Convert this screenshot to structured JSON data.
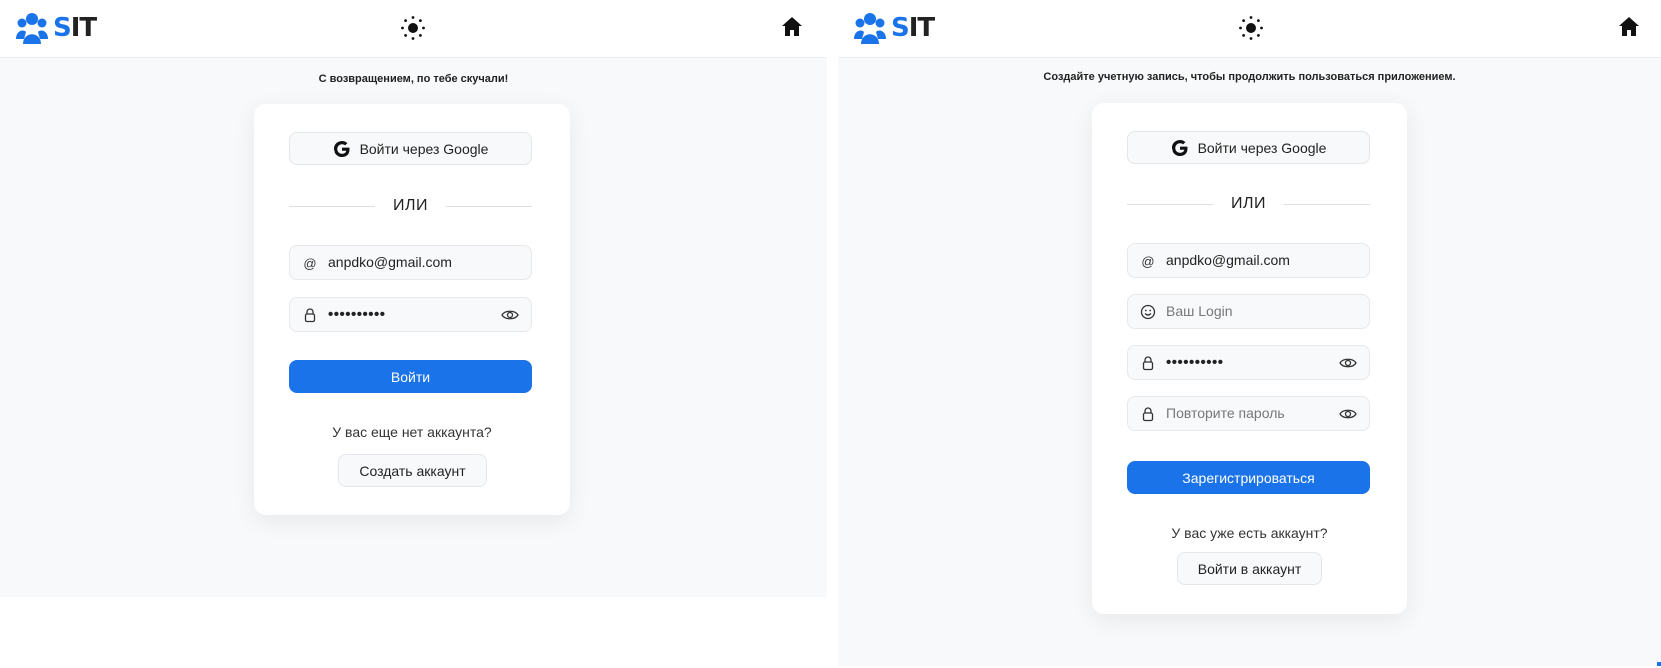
{
  "brand": {
    "logo_s": "S",
    "logo_it": "IT"
  },
  "login": {
    "subtitle": "С возвращением, по тебе скучали!",
    "google_label": "Войти через Google",
    "divider": "ИЛИ",
    "email_icon": "@",
    "email_value": "anpdko@gmail.com",
    "password_value": "••••••••••",
    "submit_label": "Войти",
    "question": "У вас еще нет аккаунта?",
    "switch_label": "Создать аккаунт"
  },
  "register": {
    "subtitle": "Создайте учетную запись, чтобы продолжить пользоваться приложением.",
    "google_label": "Войти через Google",
    "divider": "ИЛИ",
    "email_icon": "@",
    "email_value": "anpdko@gmail.com",
    "login_placeholder": "Ваш Login",
    "password_value": "••••••••••",
    "repeat_placeholder": "Повторите пароль",
    "submit_label": "Зарегистрироваться",
    "question": "У вас уже есть аккаунт?",
    "switch_label": "Войти в аккаунт"
  },
  "icons": {
    "logo": "users-icon",
    "theme": "sun-icon",
    "home": "home-icon",
    "google": "google-icon",
    "email": "at-icon",
    "login": "smile-icon",
    "password": "lock-icon",
    "visibility": "eye-icon"
  },
  "colors": {
    "accent": "#1a73e8",
    "background": "#f8f9fa",
    "card": "#ffffff"
  }
}
